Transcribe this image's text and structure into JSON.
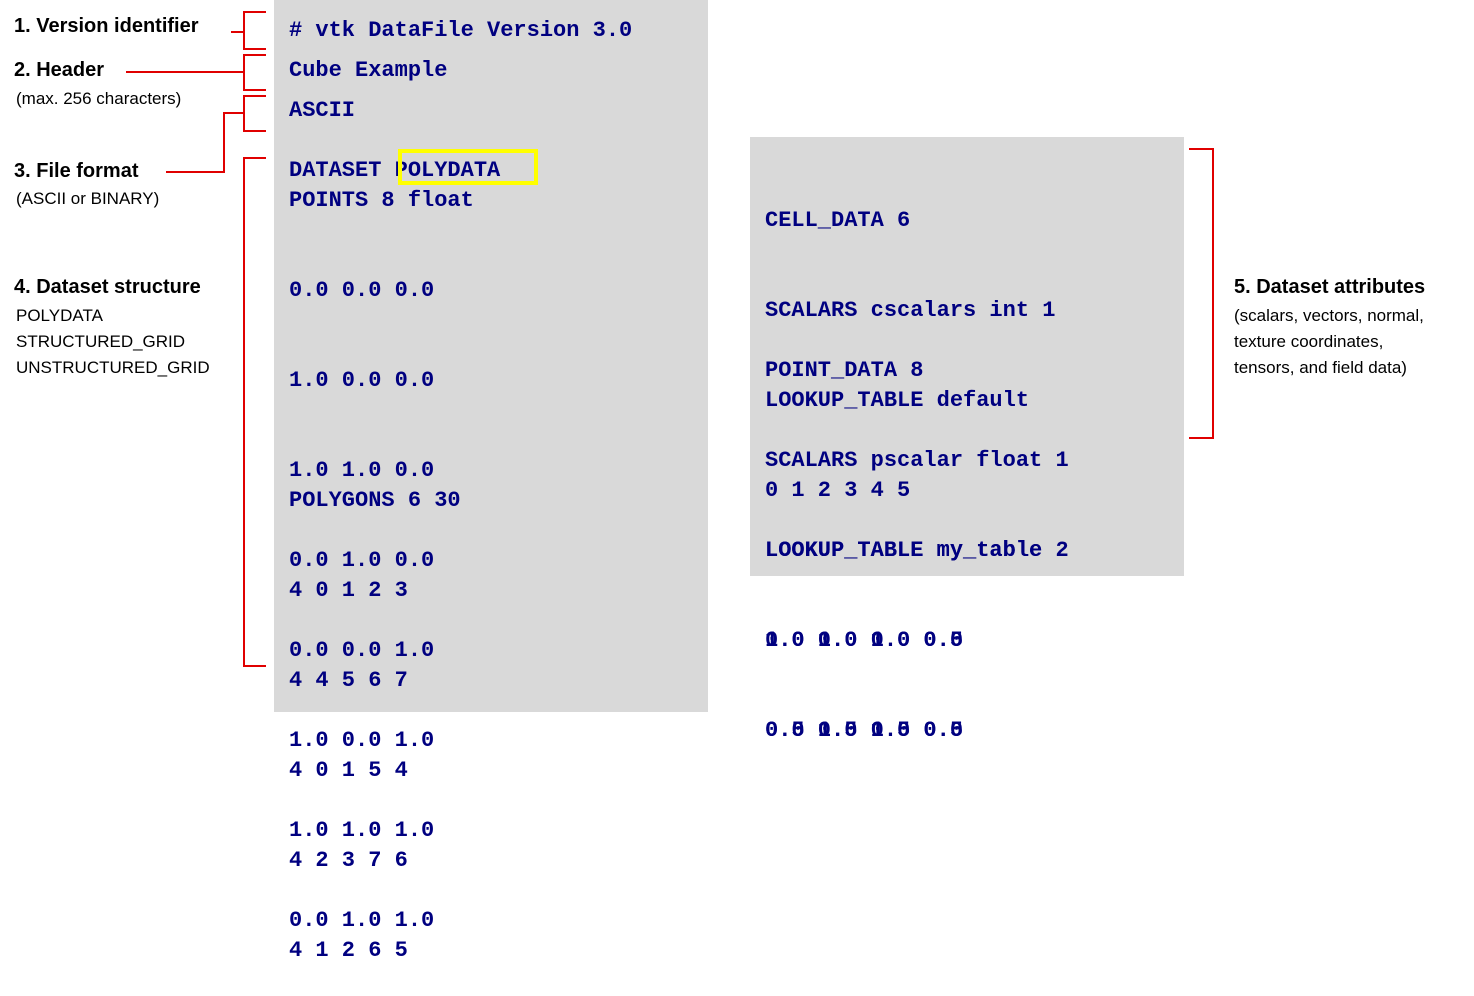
{
  "labels": {
    "version": {
      "title": "1. Version identifier"
    },
    "header": {
      "title": "2. Header",
      "sub": "(max. 256 characters)"
    },
    "format": {
      "title": "3. File format",
      "sub": "(ASCII or BINARY)"
    },
    "structure": {
      "title": "4. Dataset structure",
      "items": [
        "POLYDATA",
        "STRUCTURED_GRID",
        "UNSTRUCTURED_GRID"
      ]
    },
    "attributes": {
      "title": "5. Dataset attributes",
      "sub": [
        "(scalars, vectors, normal,",
        "texture coordinates,",
        "tensors, and field data)"
      ]
    }
  },
  "file": {
    "version_line": "# vtk DataFile Version 3.0",
    "header_line": "Cube Example",
    "format_line": "ASCII",
    "dataset_keyword": "DATASET",
    "dataset_type": "POLYDATA",
    "points_header": "POINTS 8 float",
    "points": [
      "0.0 0.0 0.0",
      "1.0 0.0 0.0",
      "1.0 1.0 0.0",
      "0.0 1.0 0.0",
      "0.0 0.0 1.0",
      "1.0 0.0 1.0",
      "1.0 1.0 1.0",
      "0.0 1.0 1.0"
    ],
    "polygons_header": "POLYGONS 6 30",
    "polygons": [
      "4 0 1 2 3",
      "4 4 5 6 7",
      "4 0 1 5 4",
      "4 2 3 7 6",
      "4 1 2 6 5"
    ]
  },
  "attributes": {
    "cell_lines": [
      "CELL_DATA 6",
      "SCALARS cscalars int 1",
      "LOOKUP_TABLE default",
      "0 1 2 3 4 5"
    ],
    "point_lines": [
      "POINT_DATA 8",
      "SCALARS pscalar float 1",
      "LOOKUP_TABLE my_table",
      "0.0 1.0 1.0 0.0",
      "0.0 1.0 1.0 0.0"
    ],
    "table_lines": [
      "LOOKUP_TABLE my_table 2",
      "1.0 0.0 0.0 0.5",
      "0.5 0.5 0.5 0.5"
    ]
  },
  "colors": {
    "code_text": "#000080",
    "panel_bg": "#d9d9d9",
    "bracket": "#e00000",
    "highlight": "#ffff00"
  }
}
